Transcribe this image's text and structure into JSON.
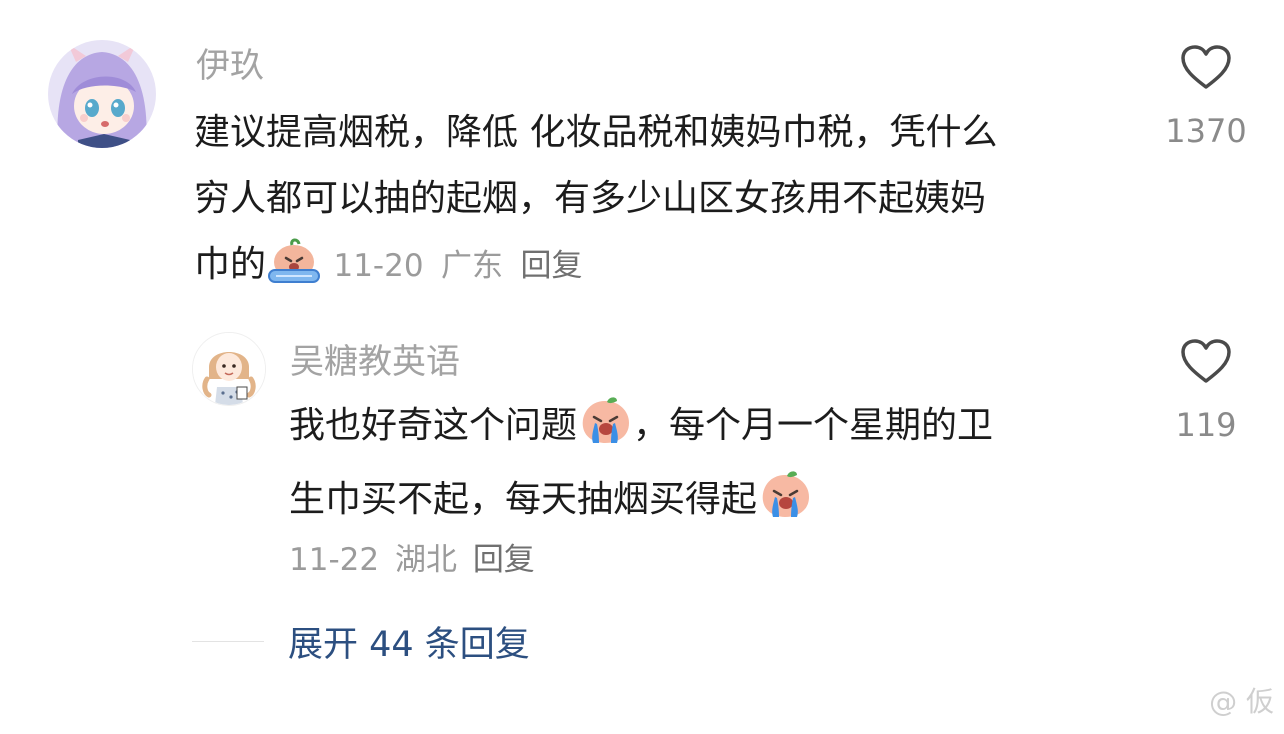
{
  "comments": [
    {
      "username": "伊玖",
      "text_lines": [
        "建议提高烟税，降低 化妆品税和姨妈巾税，凭什么",
        "穷人都可以抽的起烟，有多少山区女孩用不起姨妈",
        "巾的"
      ],
      "emoji_icon": "crying-face-emoji",
      "date": "11-20",
      "location": "广东",
      "reply_label": "回复",
      "likes": "1370"
    },
    {
      "username": "吴糖教英语",
      "text_line1_a": "我也好奇这个问题",
      "text_line1_b": "，每个月一个星期的卫",
      "text_line2": "生巾买不起，每天抽烟买得起",
      "emoji_icon": "crying-peach-emoji",
      "date": "11-22",
      "location": "湖北",
      "reply_label": "回复",
      "likes": "119"
    }
  ],
  "expand_replies": "展开 44 条回复",
  "watermark": "@ 仮",
  "icons": {
    "like": "heart-outline-icon"
  },
  "colors": {
    "username": "#a3a3a3",
    "text": "#1c1c1c",
    "meta": "#9b9b9b",
    "link": "#2c4f80"
  }
}
